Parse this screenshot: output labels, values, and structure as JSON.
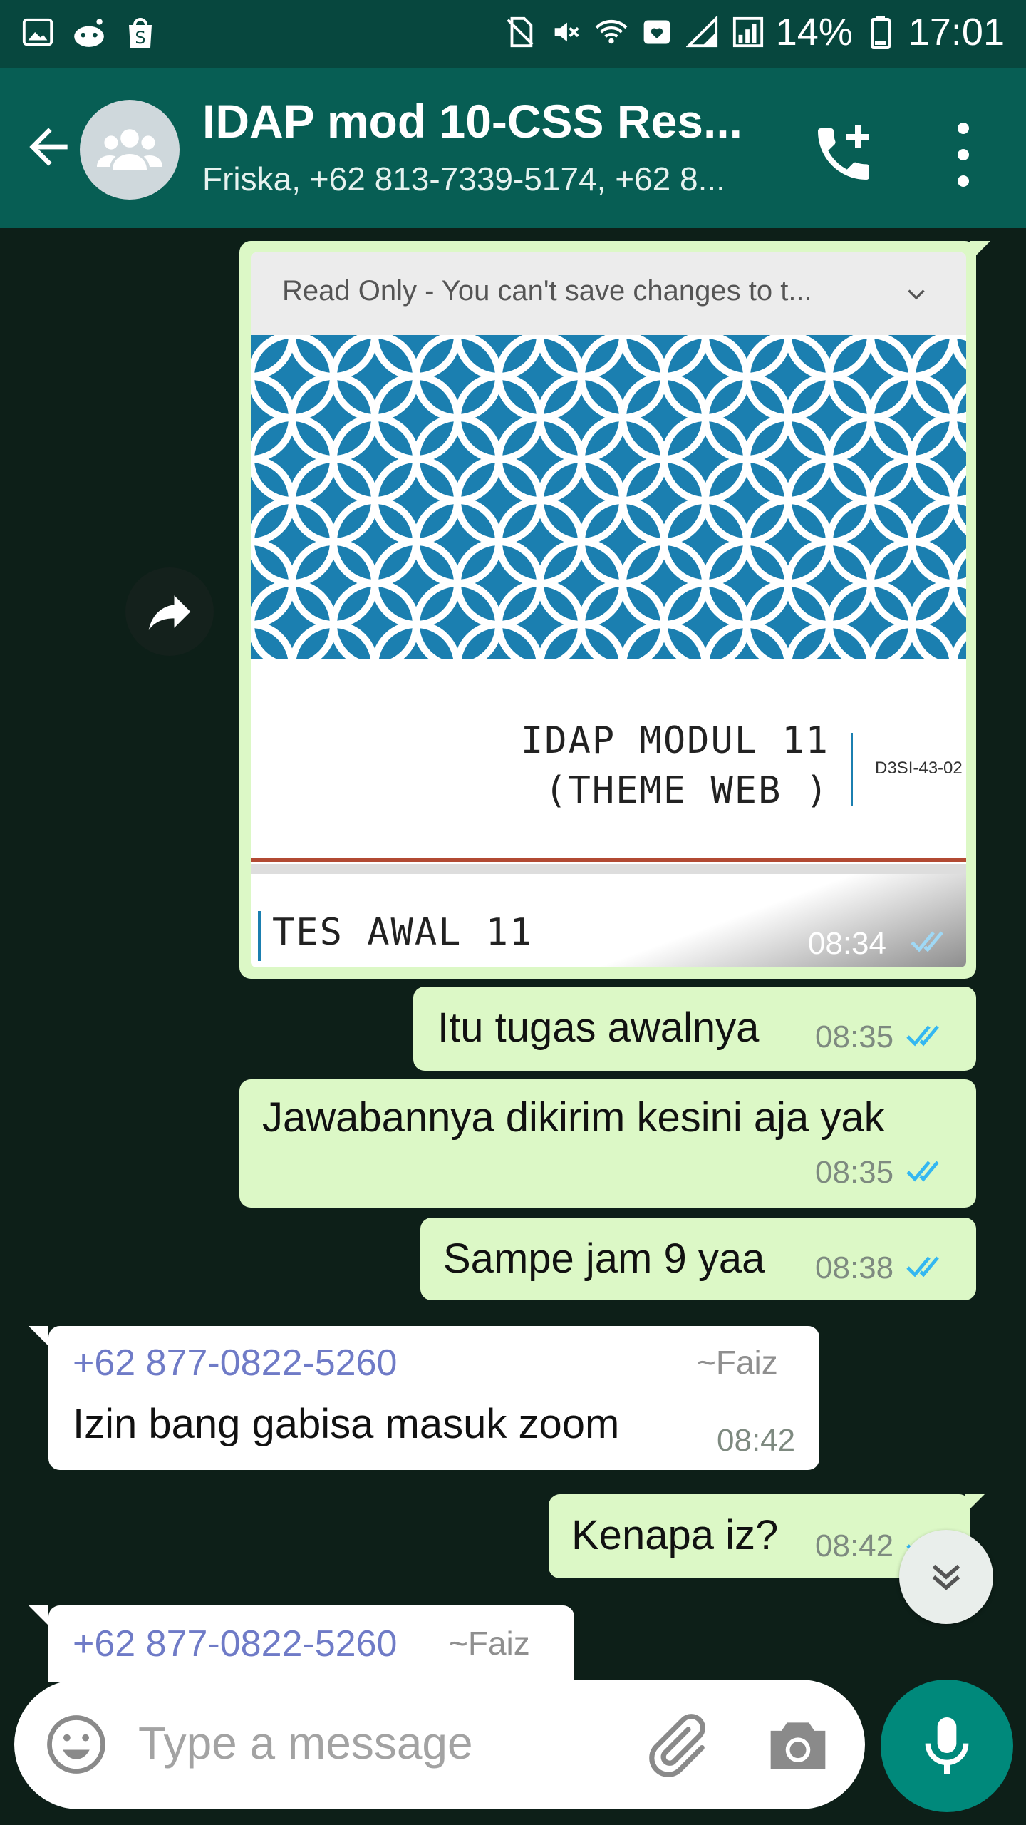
{
  "status_bar": {
    "battery": "14%",
    "time": "17:01",
    "left_icons": [
      "gallery-icon",
      "reddit-icon",
      "shopping-bag-icon"
    ],
    "right_icons": [
      "sim-off-icon",
      "mute-icon",
      "wifi-icon",
      "heart-notification-icon",
      "signal-icon",
      "signal-icon",
      "battery-icon"
    ]
  },
  "header": {
    "title": "IDAP mod 10-CSS Res...",
    "subtitle": "Friska, +62 813-7339-5174, +62 8..."
  },
  "colors": {
    "header": "#075e54",
    "statusbar": "#07473e",
    "chat_background": "#0d1f18",
    "outgoing_bubble": "#dcf8c6",
    "incoming_bubble": "#ffffff",
    "sender": "#6f7bc7",
    "read_ticks": "#34b7f1",
    "mic_button": "#00897b"
  },
  "document": {
    "bar_text": "Read Only - You can't save changes to t...",
    "slide_title_line1": "IDAP MODUL 11",
    "slide_title_line2": "(THEME WEB )",
    "slide_code": "D3SI-43-02",
    "footer_text": "TES AWAL 11",
    "time": "08:34"
  },
  "messages": [
    {
      "text": "Itu tugas awalnya",
      "time": "08:35"
    },
    {
      "text": "Jawabannya dikirim kesini aja yak",
      "time": "08:35"
    },
    {
      "text": "Sampe jam 9 yaa",
      "time": "08:38"
    },
    {
      "sender": "+62 877-0822-5260",
      "alias": "~Faiz",
      "text": "Izin bang gabisa masuk zoom",
      "time": "08:42"
    },
    {
      "text": "Kenapa iz?",
      "time": "08:42"
    },
    {
      "sender": "+62 877-0822-5260",
      "alias": "~Faiz"
    }
  ],
  "composer": {
    "placeholder": "Type a message"
  }
}
